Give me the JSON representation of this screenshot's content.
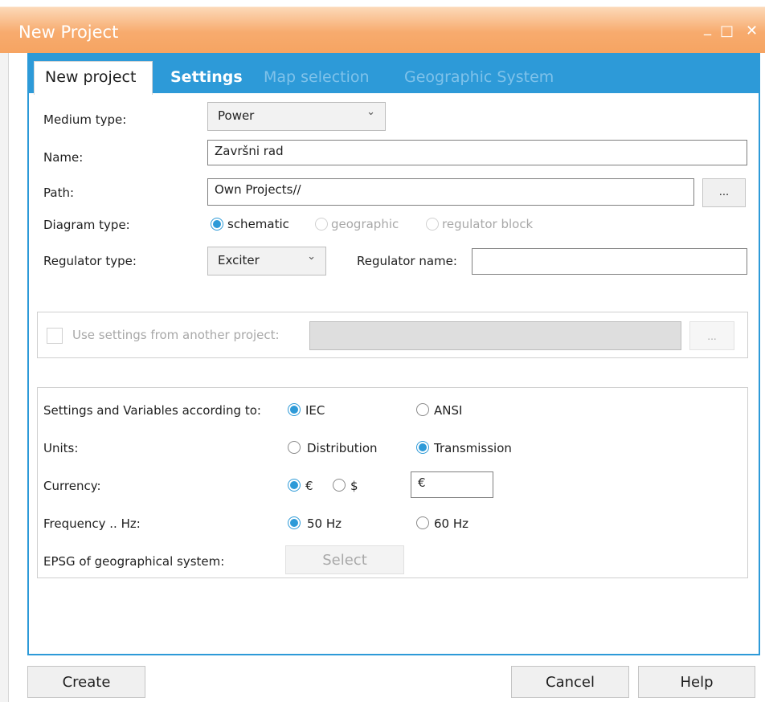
{
  "window": {
    "title": "New Project",
    "minimize_glyph": "_",
    "maximize_glyph": "□",
    "close_glyph": "✕"
  },
  "tabs": [
    {
      "label": "New project",
      "state": "active"
    },
    {
      "label": "Settings",
      "state": "enabled"
    },
    {
      "label": "Map selection",
      "state": "disabled"
    },
    {
      "label": "Geographic System",
      "state": "disabled"
    }
  ],
  "form": {
    "medium_type_label": "Medium type:",
    "medium_type_value": "Power",
    "name_label": "Name:",
    "name_value": "Završni rad",
    "path_label": "Path:",
    "path_value": "Own Projects//",
    "browse_label": "...",
    "diagram_type_label": "Diagram type:",
    "diagram_types": [
      "schematic",
      "geographic",
      "regulator block"
    ],
    "diagram_type_selected": "schematic",
    "regulator_type_label": "Regulator type:",
    "regulator_type_value": "Exciter",
    "regulator_name_label": "Regulator name:",
    "regulator_name_value": ""
  },
  "another_project": {
    "checkbox_label": "Use settings from another project:",
    "path_value": "",
    "browse_label": "..."
  },
  "standards": {
    "settings_label": "Settings and Variables according to:",
    "settings_options": [
      "IEC",
      "ANSI"
    ],
    "settings_selected": "IEC",
    "units_label": "Units:",
    "units_options": [
      "Distribution",
      "Transmission"
    ],
    "units_selected": "Transmission",
    "currency_label": "Currency:",
    "currency_options": [
      "€",
      "$"
    ],
    "currency_selected": "€",
    "currency_value": "€",
    "frequency_label": "Frequency .. Hz:",
    "frequency_options": [
      "50 Hz",
      "60 Hz"
    ],
    "frequency_selected": "50 Hz",
    "epsg_label": "EPSG of geographical system:",
    "select_label": "Select"
  },
  "footer": {
    "create_label": "Create",
    "cancel_label": "Cancel",
    "help_label": "Help"
  },
  "colors": {
    "accent": "#2d9ad8",
    "titlebar": "#f6a462"
  }
}
